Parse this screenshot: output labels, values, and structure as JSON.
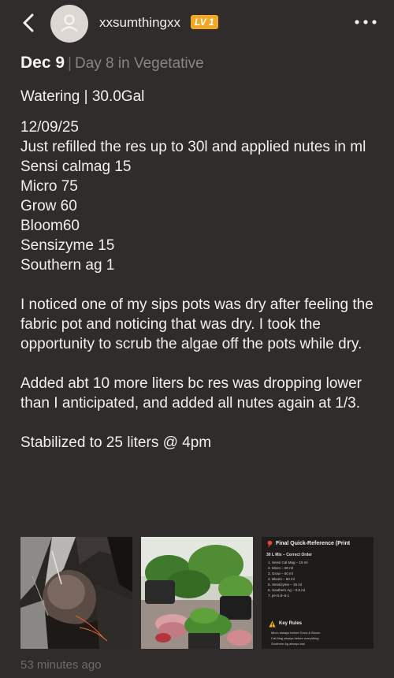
{
  "header": {
    "username": "xxsumthingxx",
    "level_badge": "LV 1"
  },
  "entry": {
    "date": "Dec 9",
    "separator": "|",
    "phase": "Day 8 in Vegetative",
    "watering": "Watering | 30.0Gal"
  },
  "body_lines": [
    "12/09/25",
    "Just refilled the res up to 30l and applied nutes in ml",
    "Sensi calmag 15",
    "Micro 75",
    "Grow 60",
    "Bloom60",
    "Sensizyme 15",
    "Southern ag 1",
    "I noticed one of my sips pots was dry after feeling the fabric pot and noticing that was dry. I took the opportunity to scrub the algae off the pots while dry.",
    "Added abt 10 more liters bc res was dropping lower than I anticipated, and added all nutes again at 1/3.",
    "Stabilized to 25 liters @ 4pm"
  ],
  "reference_card": {
    "title": "Final Quick-Reference (Print",
    "subtitle": "30 L Mix – Correct Order",
    "items": [
      "1. Sensi Cal-Mag – 15 ml",
      "2. Micro – 90 ml",
      "3. Grow – 60 ml",
      "4. Bloom – 60 ml",
      "5. Sensizyme – 15 ml",
      "6. Southern Ag – 0.6 ml",
      "7. pH 5.5–6.1"
    ],
    "rules_title": "Key Rules",
    "rules": [
      "Micro always before Grow & Bloom",
      "Cal-Mag always before everything",
      "Southern Ag always last"
    ]
  },
  "timestamp": "53 minutes ago",
  "colors": {
    "background": "#2f2c2b",
    "badge": "#f0a826",
    "muted": "#8a8582"
  },
  "icons": [
    "back-chevron-icon",
    "user-avatar-icon",
    "more-options-icon",
    "pin-icon",
    "warning-icon"
  ]
}
